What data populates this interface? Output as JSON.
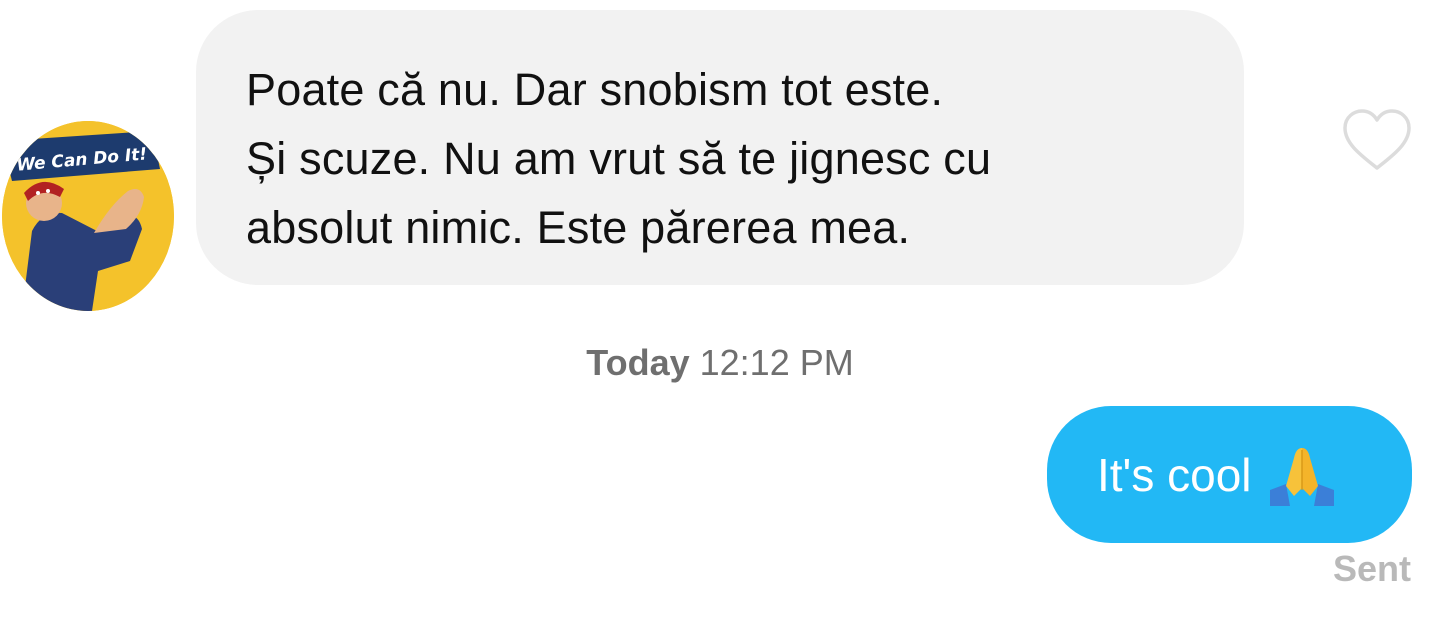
{
  "incoming": {
    "avatar_icon": "we-can-do-it-poster-avatar",
    "avatar_caption": "We Can Do It!",
    "lines": [
      "Poate că nu. Dar snobism tot este.",
      "Și scuze. Nu am vrut să te jignesc cu",
      "absolut nimic. Este părerea mea."
    ],
    "like_icon": "heart-outline-icon"
  },
  "timestamp": {
    "day": "Today",
    "time": "12:12 PM"
  },
  "outgoing": {
    "text": "It's cool",
    "emoji_icon": "folded-hands-icon",
    "status": "Sent"
  },
  "colors": {
    "incoming_bubble": "#f2f2f2",
    "outgoing_bubble": "#22b8f5",
    "timestamp_text": "#6f6f6f",
    "status_text": "#b9b9b9"
  }
}
